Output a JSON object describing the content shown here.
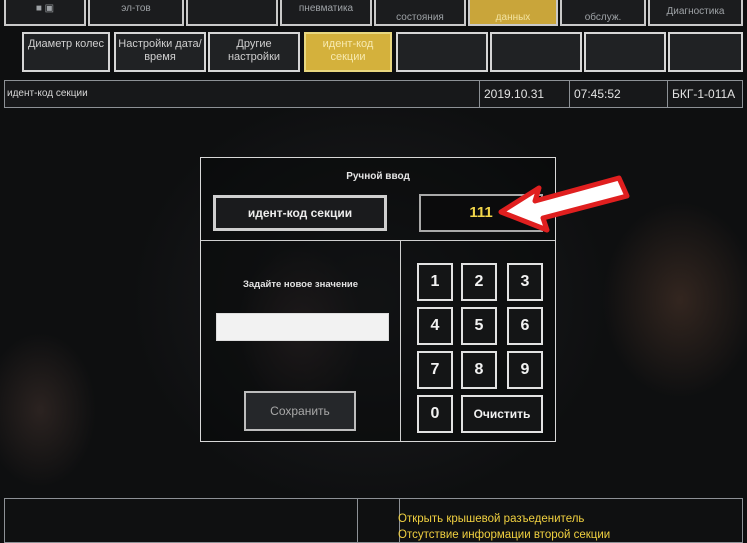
{
  "top_tabs": [
    {
      "label": "",
      "active": false
    },
    {
      "label": "эл-тов",
      "active": false
    },
    {
      "label": "",
      "active": false
    },
    {
      "label": "пневматика",
      "active": false
    },
    {
      "label": "состояния",
      "active": false
    },
    {
      "label": "данных",
      "active": true
    },
    {
      "label": "обслуж.",
      "active": false
    },
    {
      "label": "Диагностика",
      "active": false
    }
  ],
  "sub_tabs": [
    {
      "label": "Диаметр колес",
      "active": false
    },
    {
      "label": "Настройки дата/время",
      "active": false
    },
    {
      "label": "Другие настройки",
      "active": false
    },
    {
      "label": "идент-код секции",
      "active": true
    },
    {
      "label": "",
      "active": false
    },
    {
      "label": "",
      "active": false
    },
    {
      "label": "",
      "active": false
    },
    {
      "label": "",
      "active": false
    }
  ],
  "status": {
    "title": "идент-код секции",
    "date": "2019.10.31",
    "time": "07:45:52",
    "unit_id": "БКГ-1-011А"
  },
  "dialog": {
    "title": "Ручной ввод",
    "parameter_label": "идент-код секции",
    "current_value": "111",
    "prompt": "Задайте новое значение",
    "new_value": "",
    "save_label": "Сохранить",
    "keys": [
      "1",
      "2",
      "3",
      "4",
      "5",
      "6",
      "7",
      "8",
      "9",
      "0"
    ],
    "clear_label": "Очистить"
  },
  "messages": {
    "line1": "Открыть крышевой разъеденитель",
    "line2": "Отсутствие информации второй секции"
  },
  "colors": {
    "accent": "#d4b13c",
    "value_text": "#f1d54a",
    "message_text": "#f0d040",
    "arrow": "#e01f1f"
  }
}
